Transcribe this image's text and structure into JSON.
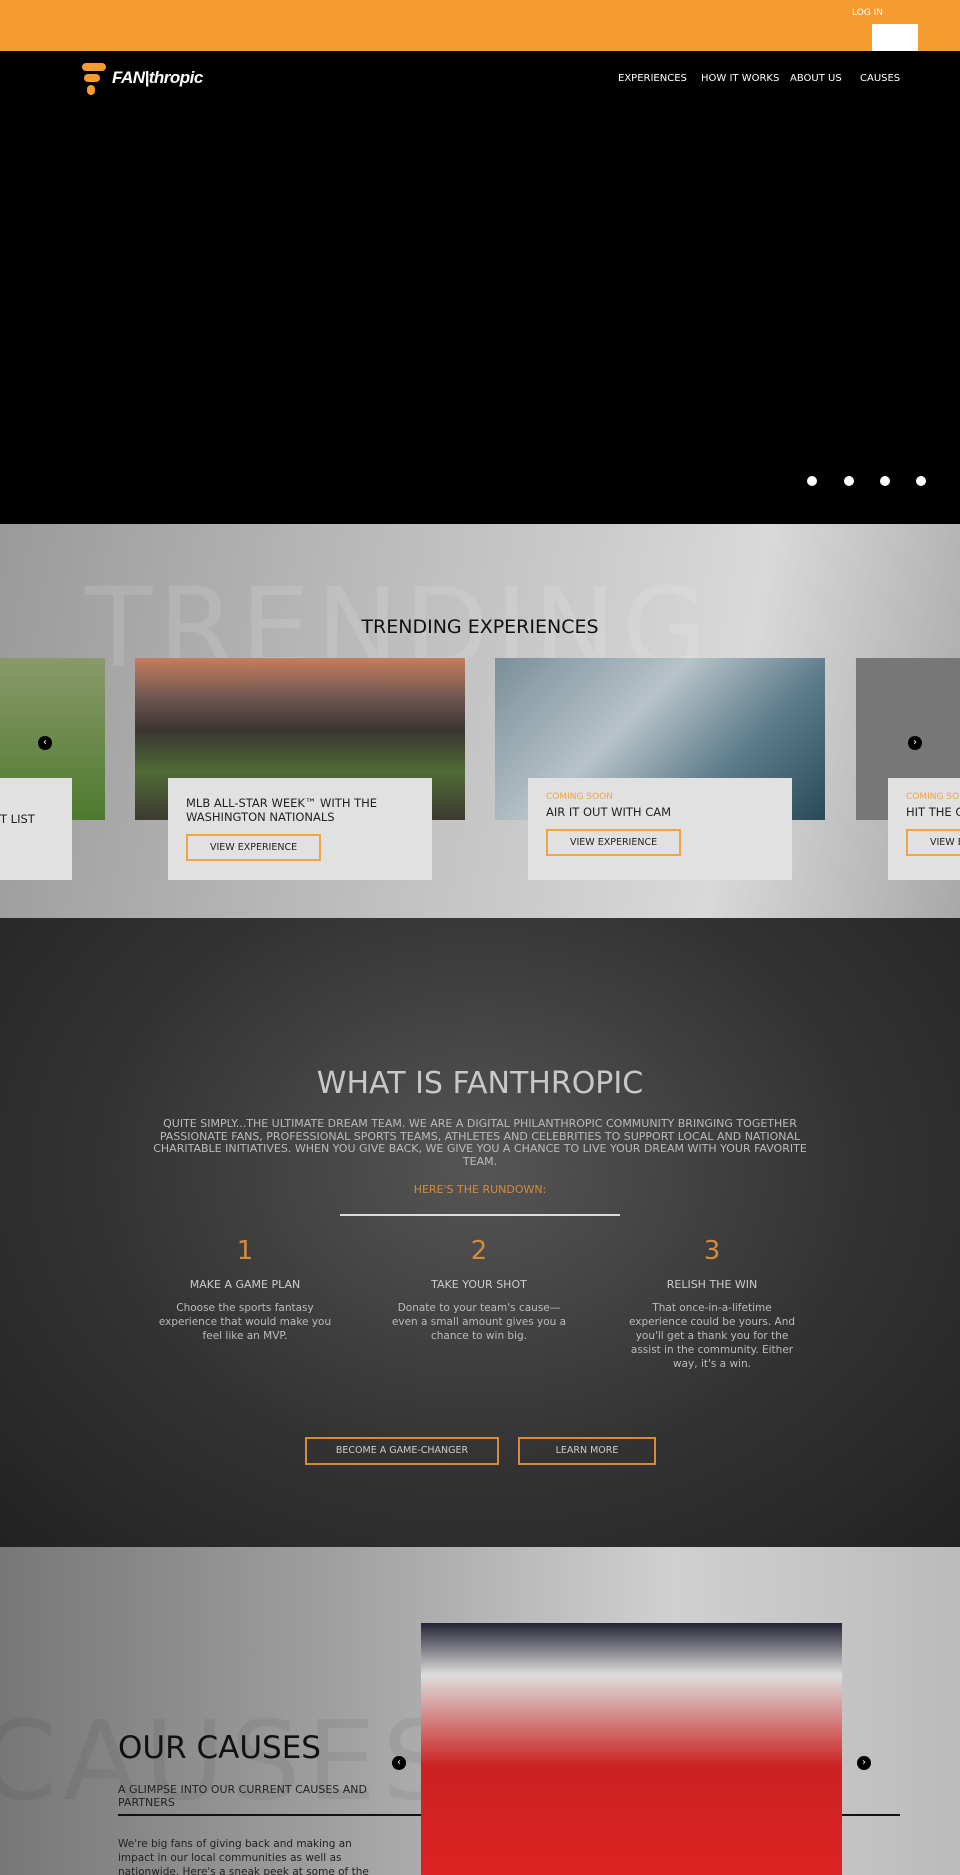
{
  "header": {
    "login": "LOG IN",
    "logo": "FAN|thropic",
    "nav": [
      "EXPERIENCES",
      "HOW IT WORKS",
      "ABOUT US",
      "CAUSES"
    ],
    "accent": "#f59b2f",
    "slides": 4
  },
  "trending": {
    "bg_word": "TRENDING",
    "title": "TRENDING EXPERIENCES",
    "cards": [
      {
        "title": "T LIST"
      },
      {
        "title": "MLB ALL-STAR WEEK™ WITH THE WASHINGTON NATIONALS",
        "button": "VIEW EXPERIENCE"
      },
      {
        "status": "COMING SOON",
        "title": "AIR IT OUT WITH CAM",
        "button": "VIEW EXPERIENCE"
      },
      {
        "status": "COMING SO",
        "title": "HIT THE C",
        "button": "VIEW E"
      }
    ]
  },
  "what": {
    "title": "WHAT IS FANTHROPIC",
    "text": "QUITE SIMPLY...THE ULTIMATE DREAM TEAM. WE ARE A DIGITAL PHILANTHROPIC COMMUNITY BRINGING TOGETHER PASSIONATE FANS, PROFESSIONAL SPORTS TEAMS, ATHLETES AND CELEBRITIES TO SUPPORT LOCAL AND NATIONAL CHARITABLE INITIATIVES. WHEN YOU GIVE BACK, WE GIVE YOU A CHANCE TO LIVE YOUR DREAM WITH YOUR FAVORITE TEAM.",
    "rundown": "HERE'S THE RUNDOWN:",
    "steps": [
      {
        "num": "1",
        "title": "MAKE A GAME PLAN",
        "desc": "Choose the sports fantasy experience that would make you feel like an MVP."
      },
      {
        "num": "2",
        "title": "TAKE YOUR SHOT",
        "desc": "Donate to your team's cause—even a small amount gives you a chance to win big."
      },
      {
        "num": "3",
        "title": "RELISH THE WIN",
        "desc": "That once-in-a-lifetime experience could be yours. And you'll get a thank you for the assist in the community. Either way, it's a win."
      }
    ],
    "btn1": "BECOME A GAME-CHANGER",
    "btn2": "LEARN MORE"
  },
  "causes": {
    "bg_word": "CAUSES",
    "title": "OUR CAUSES",
    "subtitle": "A GLIMPSE INTO OUR CURRENT CAUSES AND PARTNERS",
    "text": "We're big fans of giving back and making an impact in our local communities as well as nationwide. Here's a sneak peek at some of the local and"
  }
}
